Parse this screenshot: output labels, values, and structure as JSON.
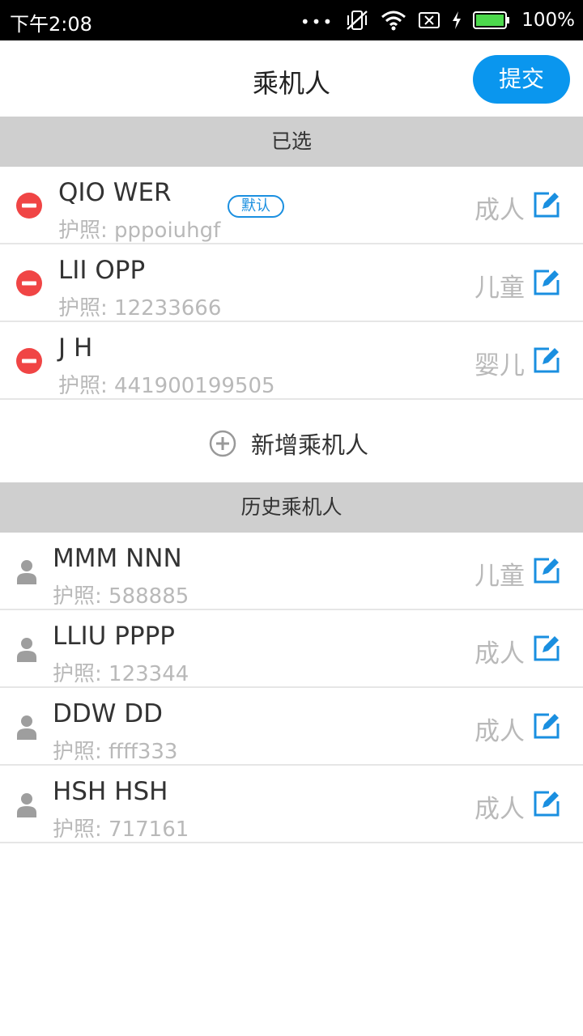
{
  "status": {
    "time": "下午2:08",
    "dots": "•••",
    "battery": "100%"
  },
  "header": {
    "title": "乘机人",
    "submit_label": "提交"
  },
  "selected_section": {
    "header": "已选",
    "passengers": [
      {
        "name": "QIO WER",
        "passport": "护照: pppoiuhgf",
        "type": "成人",
        "badge": "默认"
      },
      {
        "name": "LII OPP",
        "passport": "护照: 12233666",
        "type": "儿童"
      },
      {
        "name": "J H",
        "passport": "护照: 441900199505",
        "type": "婴儿"
      }
    ],
    "add_label": "新增乘机人"
  },
  "history_section": {
    "header": "历史乘机人",
    "passengers": [
      {
        "name": "MMM NNN",
        "passport": "护照: 588885",
        "type": "儿童"
      },
      {
        "name": "LLIU PPPP",
        "passport": "护照: 123344",
        "type": "成人"
      },
      {
        "name": "DDW DD",
        "passport": "护照: ffff333",
        "type": "成人"
      },
      {
        "name": "HSH HSH",
        "passport": "护照: 717161",
        "type": "成人"
      }
    ]
  },
  "icons": {
    "remove": "remove-circle-icon",
    "edit": "edit-icon",
    "person": "person-icon",
    "add": "add-circle-icon"
  },
  "colors": {
    "accent": "#0a96ee",
    "remove": "#f04545",
    "section_bg": "#cfcfcf",
    "muted_text": "#b9b9b9"
  }
}
